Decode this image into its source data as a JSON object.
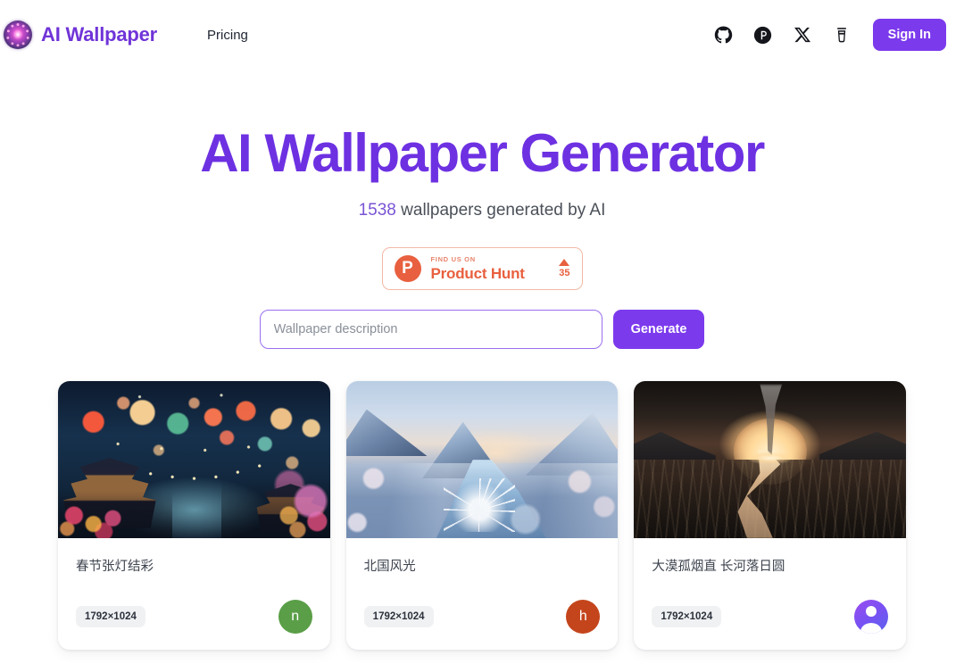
{
  "header": {
    "logo_icon": "purple-orb-logo-icon",
    "brand_name": "AI Wallpaper",
    "nav_items": [
      {
        "label": "Pricing",
        "name": "nav-pricing"
      }
    ],
    "social_icons": [
      {
        "name": "github-icon",
        "label": "GitHub"
      },
      {
        "name": "product-hunt-icon",
        "label": "Product Hunt"
      },
      {
        "name": "x-twitter-icon",
        "label": "X"
      },
      {
        "name": "buy-me-a-coffee-icon",
        "label": "Buy Me A Coffee"
      }
    ],
    "sign_in_label": "Sign In"
  },
  "hero": {
    "title": "AI Wallpaper Generator",
    "subtitle_count": "1538",
    "subtitle_text": " wallpapers generated by AI"
  },
  "product_hunt": {
    "logo_letter": "P",
    "kicker": "FIND US ON",
    "name": "Product Hunt",
    "upvote_count": "35"
  },
  "search": {
    "placeholder": "Wallpaper description",
    "value": "",
    "generate_label": "Generate"
  },
  "gallery": {
    "cards": [
      {
        "title": "春节张灯结彩",
        "size": "1792×1024",
        "avatar_letter": "n",
        "avatar_color": "#5a9e47",
        "avatar_type": "letter",
        "art": "art-lantern",
        "alt": "Chinese New Year lantern festival with pagodas and glowing lanterns"
      },
      {
        "title": "北国风光",
        "size": "1792×1024",
        "avatar_letter": "h",
        "avatar_color": "#c4451c",
        "avatar_type": "letter",
        "art": "art-snow",
        "alt": "Snow covered mountains with a frozen winding river at dusk"
      },
      {
        "title": "大漠孤烟直 长河落日圆",
        "size": "1792×1024",
        "avatar_letter": "",
        "avatar_color": "",
        "avatar_type": "person",
        "art": "art-desert",
        "alt": "Desert sunset with lone smoke column and a long winding river"
      }
    ]
  },
  "colors": {
    "brand_purple": "#7034d8",
    "hero_purple": "#6d31e2",
    "button_purple": "#7c3aed",
    "product_hunt_orange": "#e8603f",
    "badge_gray": "#f0f1f3"
  }
}
